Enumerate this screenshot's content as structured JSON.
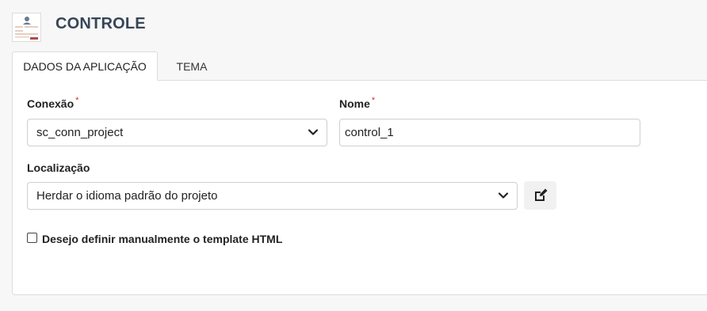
{
  "header": {
    "title": "CONTROLE",
    "icon": "app-document-icon"
  },
  "tabs": [
    {
      "label": "DADOS DA APLICAÇÃO",
      "active": true
    },
    {
      "label": "TEMA",
      "active": false
    }
  ],
  "form": {
    "conexao": {
      "label": "Conexão",
      "required_mark": "*",
      "value": "sc_conn_project"
    },
    "nome": {
      "label": "Nome",
      "required_mark": "*",
      "value": "control_1"
    },
    "localizacao": {
      "label": "Localização",
      "value": "Herdar o idioma padrão do projeto",
      "edit_icon": "edit-icon"
    },
    "template_checkbox": {
      "label": "Desejo definir manualmente o template HTML",
      "checked": false
    }
  },
  "colors": {
    "title": "#374656",
    "required": "#c0392b",
    "tab_border": "#dcdcdc"
  }
}
